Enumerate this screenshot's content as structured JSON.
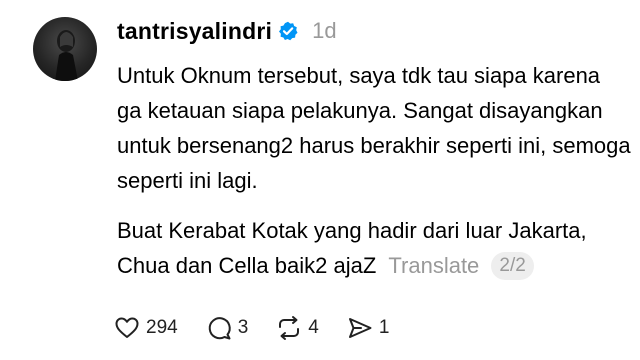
{
  "post": {
    "username": "tantrisyalindri",
    "timestamp": "1d",
    "verified_color": "#0095f6",
    "lines": [
      "Untuk Oknum tersebut, saya tdk tau siapa karena",
      "ga ketauan siapa pelakunya. Sangat disayangkan",
      "untuk bersenang2 harus berakhir seperti ini, semoga",
      "seperti ini lagi.",
      "Buat Kerabat Kotak yang hadir dari luar Jakarta,",
      "Chua dan Cella baik2 ajaZ"
    ],
    "translate_label": "Translate",
    "page_indicator": "2/2"
  },
  "actions": {
    "like_count": "294",
    "reply_count": "3",
    "repost_count": "4",
    "share_count": "1"
  },
  "icons": {
    "like": "heart-icon",
    "reply": "comment-icon",
    "repost": "repost-icon",
    "share": "send-icon",
    "verified": "verified-badge-icon"
  }
}
